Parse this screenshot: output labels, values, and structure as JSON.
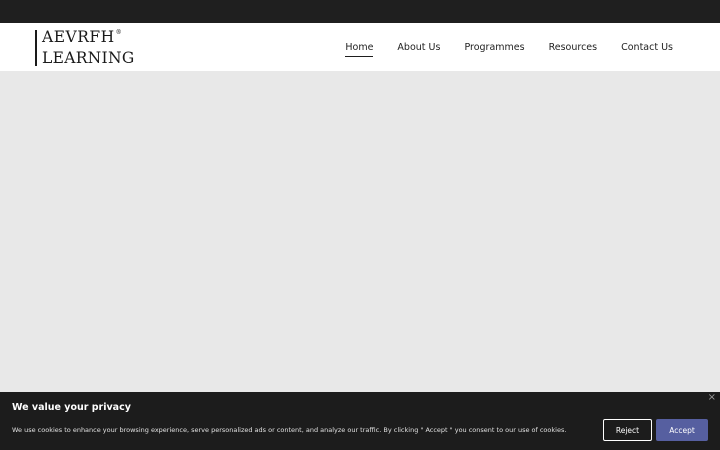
{
  "logo": {
    "line1": "AEVRFH",
    "registered": "®",
    "line2": "LEARNING"
  },
  "nav": {
    "items": [
      {
        "label": "Home",
        "active": true
      },
      {
        "label": "About Us"
      },
      {
        "label": "Programmes"
      },
      {
        "label": "Resources"
      },
      {
        "label": "Contact Us"
      }
    ]
  },
  "cookie": {
    "title": "We value your privacy",
    "text": "We use cookies to enhance your browsing experience, serve personalized ads or content, and analyze our traffic. By clicking \" Accept \" you consent to our use of cookies.",
    "reject_label": "Reject",
    "accept_label": "Accept",
    "close_label": "×"
  },
  "colors": {
    "topbar": "#1f1f1f",
    "hero_bg": "#e8e8e8",
    "cookie_bg": "#1c1c1c",
    "accept_button": "#565fa0"
  }
}
